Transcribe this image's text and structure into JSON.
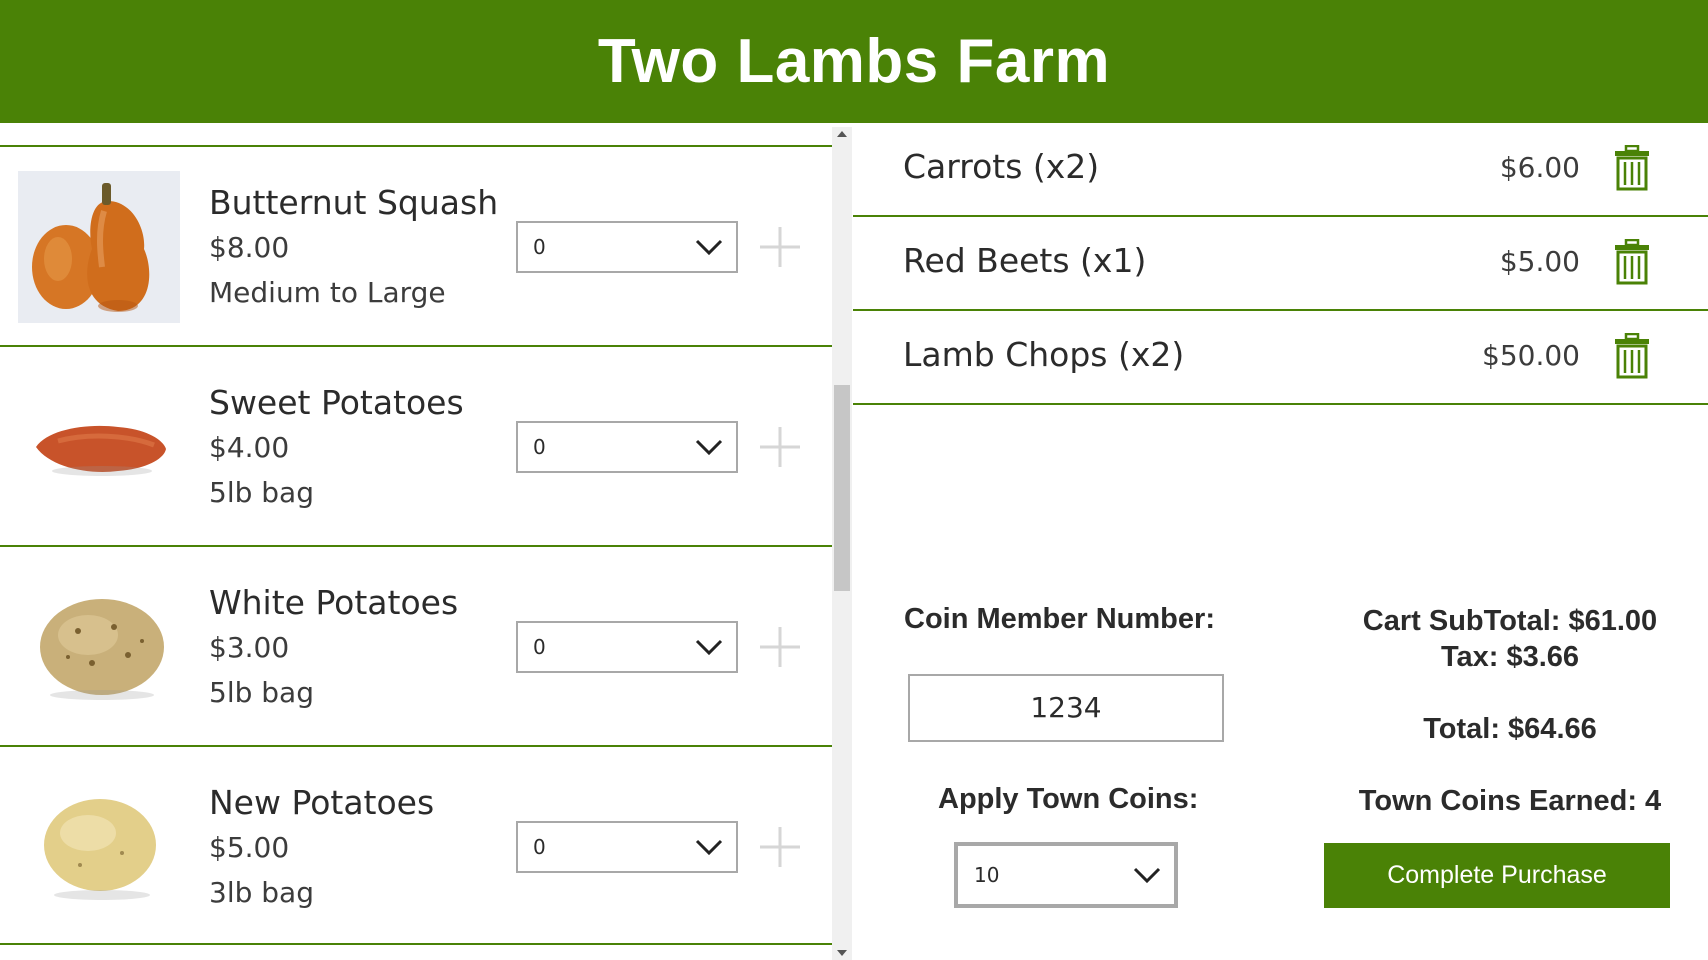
{
  "header": {
    "title": "Two Lambs Farm"
  },
  "products": [
    {
      "name": "Butternut Squash",
      "price": "$8.00",
      "desc": "Medium to Large",
      "qty": "0",
      "image": "butternut-squash"
    },
    {
      "name": "Sweet Potatoes",
      "price": "$4.00",
      "desc": "5lb bag",
      "qty": "0",
      "image": "sweet-potato"
    },
    {
      "name": "White Potatoes",
      "price": "$3.00",
      "desc": "5lb bag",
      "qty": "0",
      "image": "white-potato"
    },
    {
      "name": "New Potatoes",
      "price": "$5.00",
      "desc": "3lb bag",
      "qty": "0",
      "image": "new-potato"
    }
  ],
  "cart": {
    "items": [
      {
        "name": "Carrots (x2)",
        "price": "$6.00"
      },
      {
        "name": "Red Beets (x1)",
        "price": "$5.00"
      },
      {
        "name": "Lamb Chops (x2)",
        "price": "$50.00"
      }
    ]
  },
  "checkout": {
    "member_label": "Coin Member Number:",
    "member_number": "1234",
    "apply_label": "Apply Town Coins:",
    "apply_value": "10",
    "subtotal": "Cart SubTotal: $61.00",
    "tax": "Tax: $3.66",
    "total": "Total:  $64.66",
    "coins_earned": "Town Coins Earned: 4",
    "complete_label": "Complete Purchase"
  },
  "colors": {
    "brand": "#4a8206",
    "border": "#a8a8a8"
  },
  "icons": {
    "add": "plus-icon",
    "remove": "trash-icon",
    "dropdown": "chevron-down-icon"
  }
}
